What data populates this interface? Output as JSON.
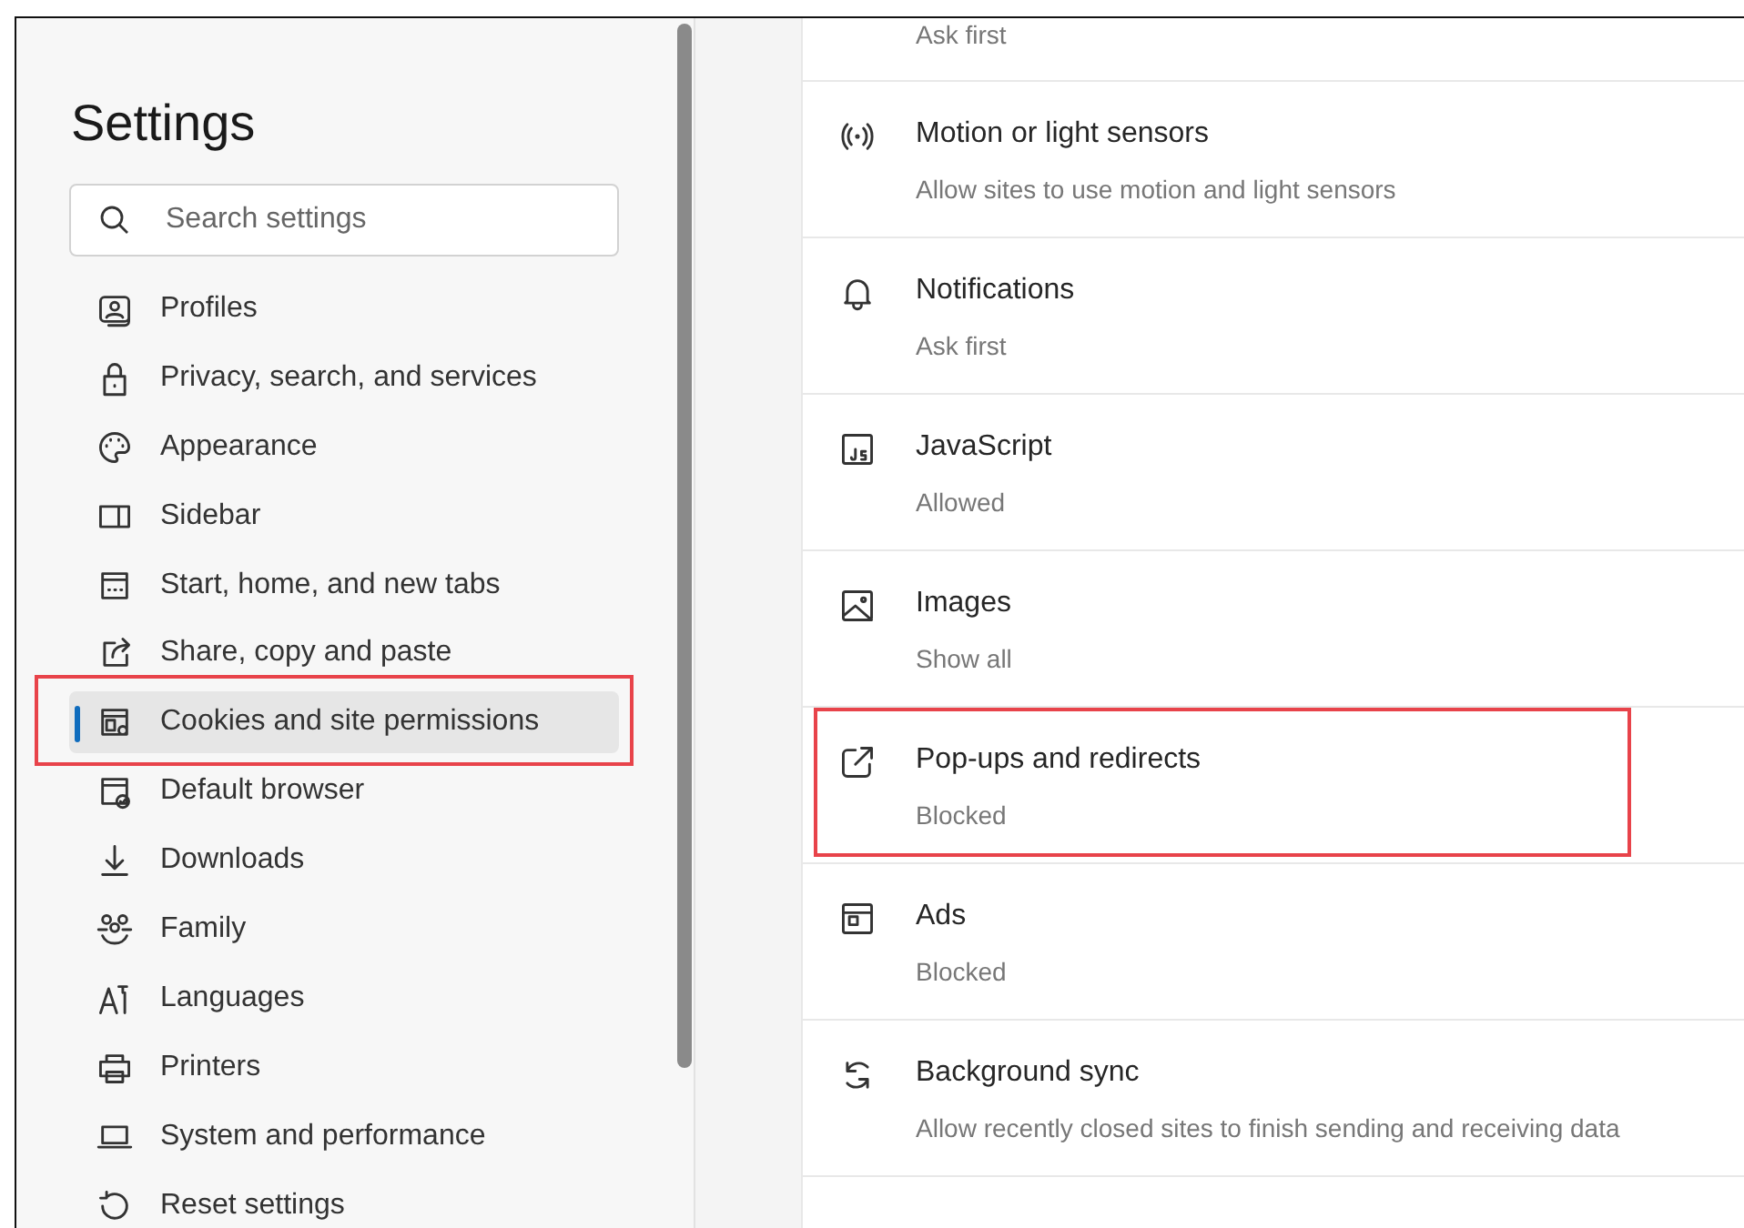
{
  "sidebar": {
    "title": "Settings",
    "search": {
      "placeholder": "Search settings"
    },
    "items": [
      {
        "label": "Profiles",
        "selected": false,
        "highlighted": false
      },
      {
        "label": "Privacy, search, and services",
        "selected": false,
        "highlighted": false
      },
      {
        "label": "Appearance",
        "selected": false,
        "highlighted": false
      },
      {
        "label": "Sidebar",
        "selected": false,
        "highlighted": false
      },
      {
        "label": "Start, home, and new tabs",
        "selected": false,
        "highlighted": false
      },
      {
        "label": "Share, copy and paste",
        "selected": false,
        "highlighted": false
      },
      {
        "label": "Cookies and site permissions",
        "selected": true,
        "highlighted": true
      },
      {
        "label": "Default browser",
        "selected": false,
        "highlighted": false
      },
      {
        "label": "Downloads",
        "selected": false,
        "highlighted": false
      },
      {
        "label": "Family",
        "selected": false,
        "highlighted": false
      },
      {
        "label": "Languages",
        "selected": false,
        "highlighted": false
      },
      {
        "label": "Printers",
        "selected": false,
        "highlighted": false
      },
      {
        "label": "System and performance",
        "selected": false,
        "highlighted": false
      },
      {
        "label": "Reset settings",
        "selected": false,
        "highlighted": false
      }
    ]
  },
  "permissions": [
    {
      "description": "Ask first",
      "highlighted": false
    },
    {
      "title": "Motion or light sensors",
      "description": "Allow sites to use motion and light sensors",
      "highlighted": false
    },
    {
      "title": "Notifications",
      "description": "Ask first",
      "highlighted": false
    },
    {
      "title": "JavaScript",
      "description": "Allowed",
      "highlighted": false
    },
    {
      "title": "Images",
      "description": "Show all",
      "highlighted": false
    },
    {
      "title": "Pop-ups and redirects",
      "description": "Blocked",
      "highlighted": true
    },
    {
      "title": "Ads",
      "description": "Blocked",
      "highlighted": false
    },
    {
      "title": "Background sync",
      "description": "Allow recently closed sites to finish sending and receiving data",
      "highlighted": false
    }
  ]
}
